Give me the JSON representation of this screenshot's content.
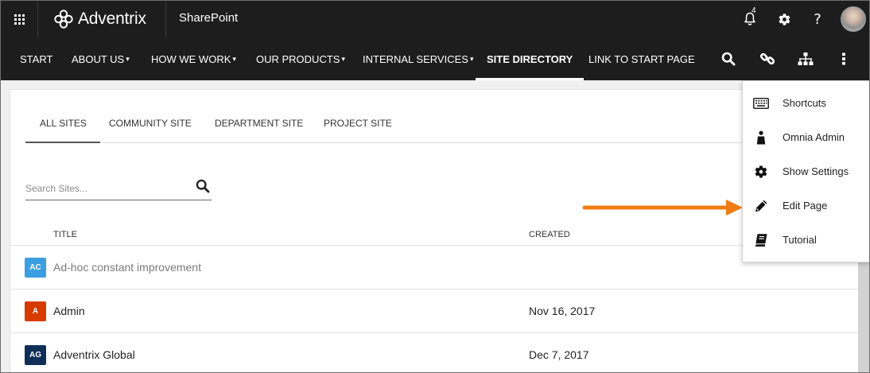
{
  "suite_bar": {
    "brand": "Adventrix",
    "app_title": "SharePoint",
    "notification_count": "4",
    "help_glyph": "?"
  },
  "nav": {
    "items": [
      {
        "label": "START",
        "dropdown": false
      },
      {
        "label": "ABOUT US",
        "dropdown": true
      },
      {
        "label": "HOW WE WORK",
        "dropdown": true
      },
      {
        "label": "OUR PRODUCTS",
        "dropdown": true
      },
      {
        "label": "INTERNAL SERVICES",
        "dropdown": true
      },
      {
        "label": "SITE DIRECTORY",
        "dropdown": false,
        "active": true
      },
      {
        "label": "LINK TO START PAGE",
        "dropdown": false
      }
    ],
    "caret": "▾",
    "icons": [
      "search-icon",
      "link-icon",
      "sitemap-icon",
      "more-vertical-icon"
    ]
  },
  "directory": {
    "tabs": [
      {
        "label": "ALL SITES",
        "active": true
      },
      {
        "label": "COMMUNITY SITE"
      },
      {
        "label": "DEPARTMENT SITE"
      },
      {
        "label": "PROJECT SITE"
      }
    ],
    "search": {
      "placeholder": "Search Sites..."
    },
    "columns": {
      "title": "TITLE",
      "created": "CREATED"
    },
    "rows": [
      {
        "initials": "AC",
        "title": "Ad-hoc constant improvement",
        "created": "",
        "color": "#3b9ee0",
        "muted": true
      },
      {
        "initials": "A",
        "title": "Admin",
        "created": "Nov 16, 2017",
        "color": "#d83b01"
      },
      {
        "initials": "AG",
        "title": "Adventrix Global",
        "created": "Dec 7, 2017",
        "color": "#0f2f57"
      }
    ]
  },
  "menu": {
    "items": [
      {
        "label": "Shortcuts",
        "icon": "keyboard-icon"
      },
      {
        "label": "Omnia Admin",
        "icon": "person-icon"
      },
      {
        "label": "Show Settings",
        "icon": "gear-icon"
      },
      {
        "label": "Edit Page",
        "icon": "pencil-icon"
      },
      {
        "label": "Tutorial",
        "icon": "book-icon"
      }
    ]
  },
  "colors": {
    "bar_background": "#1d1d1d",
    "arrow": "#f07d14"
  }
}
